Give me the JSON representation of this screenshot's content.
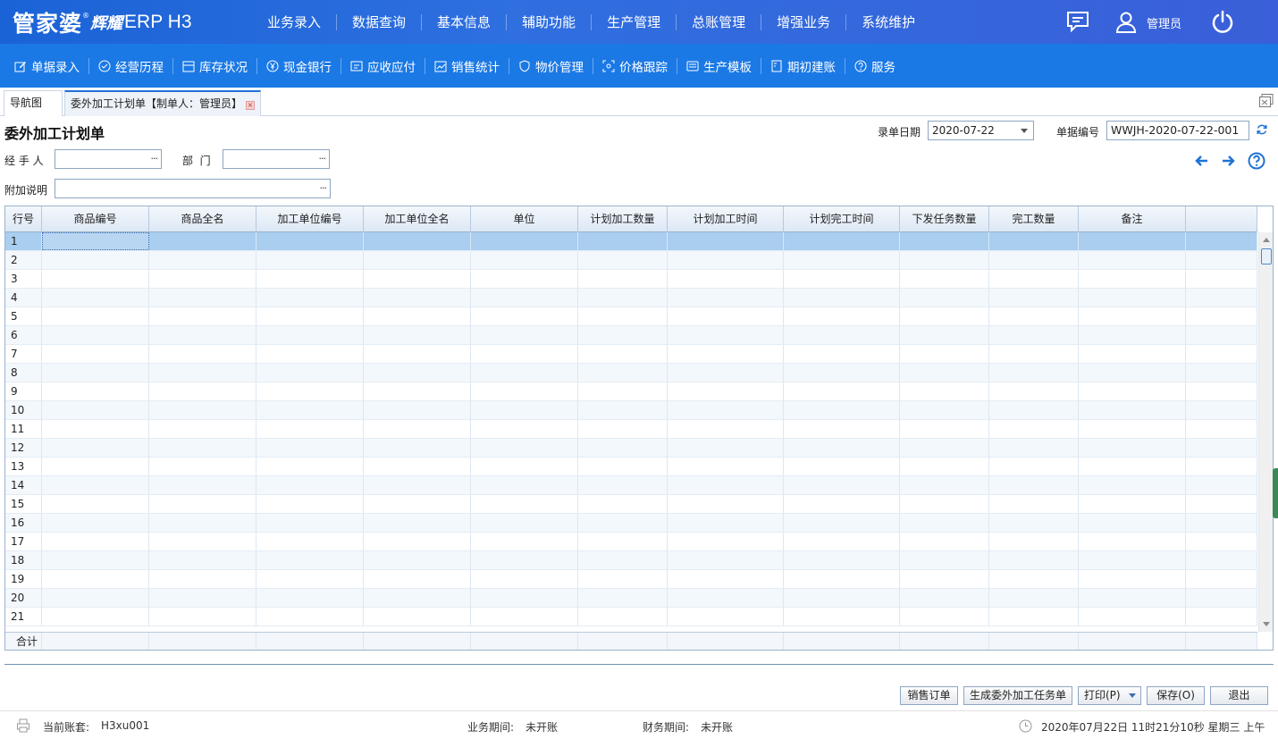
{
  "app": {
    "logo_main": "管家婆",
    "logo_reg": "®",
    "logo_sub": "辉耀",
    "logo_product": "ERP H3"
  },
  "main_nav": [
    "业务录入",
    "数据查询",
    "基本信息",
    "辅助功能",
    "生产管理",
    "总账管理",
    "增强业务",
    "系统维护"
  ],
  "user": {
    "name": "管理员"
  },
  "toolbar": [
    {
      "label": "单据录入",
      "icon": "edit-icon"
    },
    {
      "label": "经营历程",
      "icon": "check-circle-icon"
    },
    {
      "label": "库存状况",
      "icon": "inventory-icon"
    },
    {
      "label": "现金银行",
      "icon": "yuan-icon"
    },
    {
      "label": "应收应付",
      "icon": "ledger-icon"
    },
    {
      "label": "销售统计",
      "icon": "stats-icon"
    },
    {
      "label": "物价管理",
      "icon": "shield-icon"
    },
    {
      "label": "价格跟踪",
      "icon": "track-icon"
    },
    {
      "label": "生产模板",
      "icon": "template-icon"
    },
    {
      "label": "期初建账",
      "icon": "book-icon"
    },
    {
      "label": "服务",
      "icon": "help-icon"
    }
  ],
  "tabs": {
    "nav": "导航图",
    "doc": "委外加工计划单【制单人：管理员】",
    "close": "×"
  },
  "form": {
    "title": "委外加工计划单",
    "date_label": "录单日期",
    "date_value": "2020-07-22",
    "number_label": "单据编号",
    "number_value": "WWJH-2020-07-22-001",
    "handler_label": "经 手 人",
    "handler_value": "",
    "dept_label": "部  门",
    "dept_value": "",
    "note_label": "附加说明",
    "note_value": "",
    "dots": "···"
  },
  "grid": {
    "columns": [
      "行号",
      "商品编号",
      "商品全名",
      "加工单位编号",
      "加工单位全名",
      "单位",
      "计划加工数量",
      "计划加工时间",
      "计划完工时间",
      "下发任务数量",
      "完工数量",
      "备注",
      ""
    ],
    "rows": [
      "1",
      "2",
      "3",
      "4",
      "5",
      "6",
      "7",
      "8",
      "9",
      "10",
      "11",
      "12",
      "13",
      "14",
      "15",
      "16",
      "17",
      "18",
      "19",
      "20",
      "21"
    ],
    "selected_row": 1,
    "total_label": "合计"
  },
  "buttons": {
    "sales_order": "销售订单",
    "gen_task": "生成委外加工任务单",
    "print": "打印(P)",
    "save": "保存(O)",
    "exit": "退出"
  },
  "status": {
    "account_label": "当前账套:",
    "account_value": "H3xu001",
    "biz_period_label": "业务期间:",
    "biz_period_value": "未开账",
    "fin_period_label": "财务期间:",
    "fin_period_value": "未开账",
    "datetime": "2020年07月22日 11时21分10秒 星期三 上午"
  },
  "colors": {
    "topbar": "#2f6fe0",
    "toolbar": "#1b79e6",
    "selected_row": "#a9ceef",
    "accent": "#1f72d6"
  }
}
